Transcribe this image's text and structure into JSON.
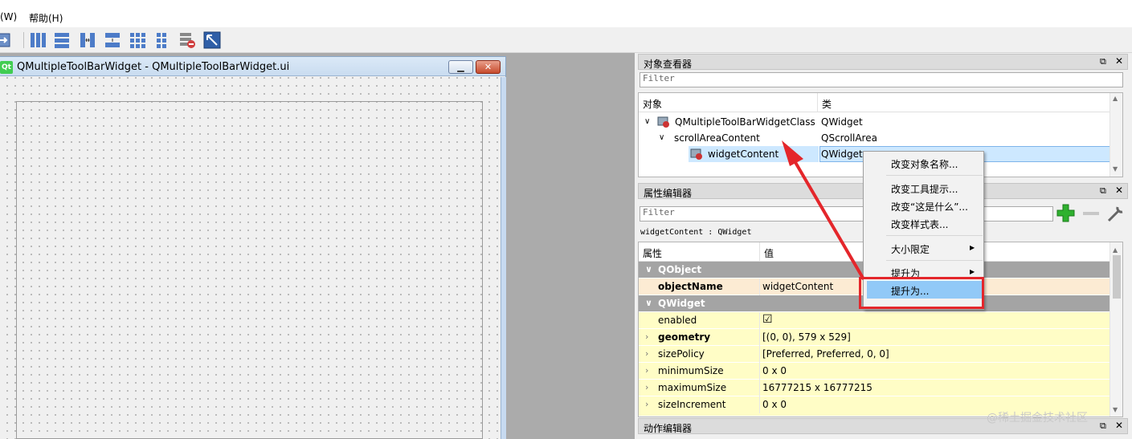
{
  "menu": {
    "window_label": "(W)",
    "help_label": "帮助(H)"
  },
  "subwindow": {
    "title": "QMultipleToolBarWidget - QMultipleToolBarWidget.ui",
    "logo": "Qt"
  },
  "object_inspector": {
    "title": "对象查看器",
    "filter_placeholder": "Filter",
    "col_object": "对象",
    "col_class": "类",
    "rows": [
      {
        "name": "QMultipleToolBarWidgetClass",
        "class": "QWidget"
      },
      {
        "name": "scrollAreaContent",
        "class": "QScrollArea"
      },
      {
        "name": "widgetContent",
        "class": "QWidget"
      }
    ]
  },
  "property_editor": {
    "title": "属性编辑器",
    "filter_placeholder": "Filter",
    "context_label": "widgetContent : QWidget",
    "col_property": "属性",
    "col_value": "值",
    "groups": {
      "qobject": "QObject",
      "qwidget": "QWidget"
    },
    "props": [
      {
        "key": "objectName",
        "value": "widgetContent"
      },
      {
        "key": "enabled",
        "value": "☑"
      },
      {
        "key": "geometry",
        "value": "[(0, 0), 579 x 529]"
      },
      {
        "key": "sizePolicy",
        "value": "[Preferred, Preferred, 0, 0]"
      },
      {
        "key": "minimumSize",
        "value": "0 x 0"
      },
      {
        "key": "maximumSize",
        "value": "16777215 x 16777215"
      },
      {
        "key": "sizeIncrement",
        "value": "0 x 0"
      }
    ]
  },
  "action_editor": {
    "title": "动作编辑器"
  },
  "context_menu": {
    "items": [
      "改变对象名称...",
      "改变工具提示...",
      "改变“这是什么”...",
      "改变样式表...",
      "大小限定",
      "提升为",
      "提升为..."
    ],
    "submenu_glyph": "▶"
  },
  "dock_buttons": {
    "float": "⧉",
    "close": "✕"
  },
  "watermark": "@稀土掘金技术社区",
  "colors": {
    "highlight": "#91c9f7",
    "annotation_red": "#e4262b",
    "group_gray": "#a4a4a4",
    "object_row": "#fcebd3",
    "widget_row": "#fffdc6"
  }
}
